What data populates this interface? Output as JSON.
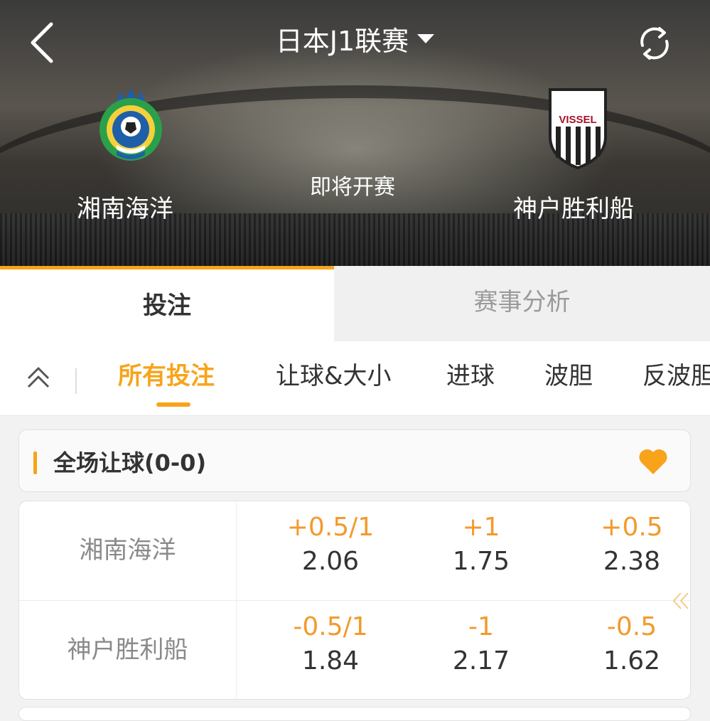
{
  "header": {
    "title": "日本J1联赛",
    "back_icon": "chevron-left-icon",
    "refresh_icon": "refresh-icon"
  },
  "match": {
    "home": {
      "name": "湘南海洋"
    },
    "away": {
      "name": "神户胜利船",
      "logo_text": "VISSEL"
    },
    "status": "即将开赛"
  },
  "tabs": [
    {
      "label": "投注",
      "active": true
    },
    {
      "label": "赛事分析",
      "active": false
    }
  ],
  "filters": {
    "items": [
      {
        "label": "所有投注",
        "active": true
      },
      {
        "label": "让球&大小"
      },
      {
        "label": "进球"
      },
      {
        "label": "波胆"
      },
      {
        "label": "反波胆"
      }
    ]
  },
  "section": {
    "title": "全场让球(0-0)",
    "favorite": true
  },
  "rows": [
    {
      "team": "湘南海洋",
      "cells": [
        {
          "hc": "+0.5/1",
          "odds": "2.06"
        },
        {
          "hc": "+1",
          "odds": "1.75"
        },
        {
          "hc": "+0.5",
          "odds": "2.38"
        }
      ]
    },
    {
      "team": "神户胜利船",
      "cells": [
        {
          "hc": "-0.5/1",
          "odds": "1.84"
        },
        {
          "hc": "-1",
          "odds": "2.17"
        },
        {
          "hc": "-0.5",
          "odds": "1.62"
        }
      ]
    }
  ],
  "colors": {
    "accent": "#f7a41a",
    "handicap": "#f39a2c",
    "text": "#333333",
    "muted": "#8a8a8a"
  }
}
